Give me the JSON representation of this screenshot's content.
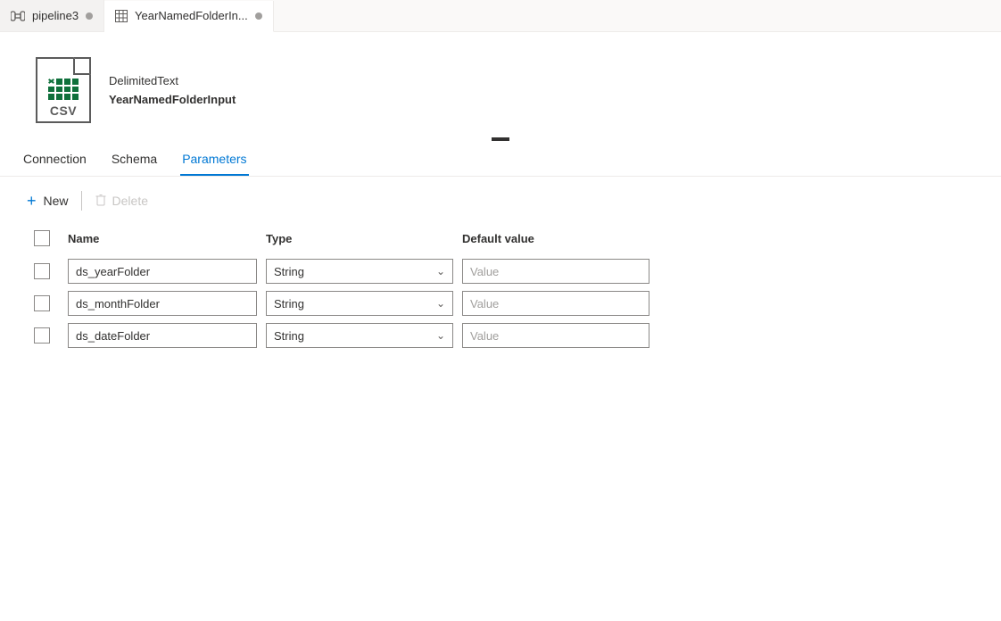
{
  "fileTabs": [
    {
      "label": "pipeline3",
      "iconType": "pipeline"
    },
    {
      "label": "YearNamedFolderIn...",
      "iconType": "dataset"
    }
  ],
  "activeTabIndex": 1,
  "dataset": {
    "kind": "DelimitedText",
    "name": "YearNamedFolderInput",
    "iconLabel": "CSV"
  },
  "subTabs": {
    "items": [
      "Connection",
      "Schema",
      "Parameters"
    ],
    "selected": "Parameters"
  },
  "toolbar": {
    "new": "New",
    "delete": "Delete"
  },
  "columns": {
    "name": "Name",
    "type": "Type",
    "defaultValue": "Default value"
  },
  "defaultValuePlaceholder": "Value",
  "typeOptions": [
    "String"
  ],
  "parameters": [
    {
      "name": "ds_yearFolder",
      "type": "String",
      "value": ""
    },
    {
      "name": "ds_monthFolder",
      "type": "String",
      "value": ""
    },
    {
      "name": "ds_dateFolder",
      "type": "String",
      "value": ""
    }
  ]
}
